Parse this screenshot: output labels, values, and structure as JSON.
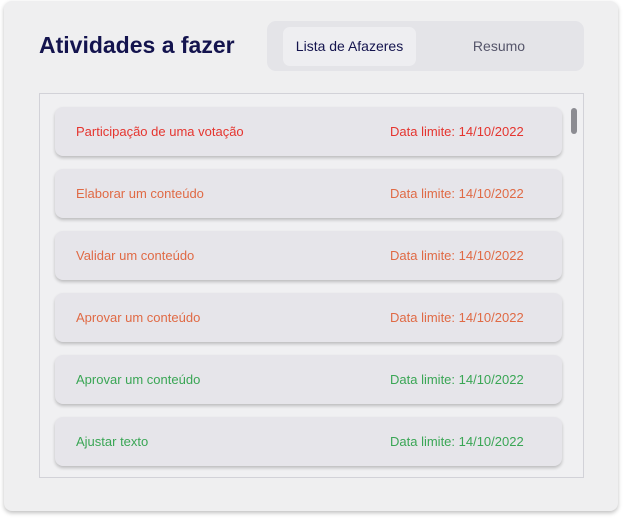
{
  "header": {
    "title": "Atividades a fazer"
  },
  "tabs": [
    {
      "label": "Lista de Afazeres",
      "active": true
    },
    {
      "label": "Resumo",
      "active": false
    }
  ],
  "tasks": [
    {
      "name": "Participação de uma votação",
      "date": "Data limite: 14/10/2022",
      "color": "#e5352f"
    },
    {
      "name": "Elaborar um conteúdo",
      "date": "Data limite: 14/10/2022",
      "color": "#e06a45"
    },
    {
      "name": "Validar um conteúdo",
      "date": "Data limite: 14/10/2022",
      "color": "#e06a45"
    },
    {
      "name": "Aprovar um conteúdo",
      "date": "Data limite: 14/10/2022",
      "color": "#e06a45"
    },
    {
      "name": "Aprovar um conteúdo",
      "date": "Data limite: 14/10/2022",
      "color": "#3aa655"
    },
    {
      "name": "Ajustar texto",
      "date": "Data limite: 14/10/2022",
      "color": "#3aa655"
    }
  ],
  "colors": {
    "title": "#14144e",
    "urgent": "#e5352f",
    "warning": "#e06a45",
    "ok": "#3aa655"
  }
}
